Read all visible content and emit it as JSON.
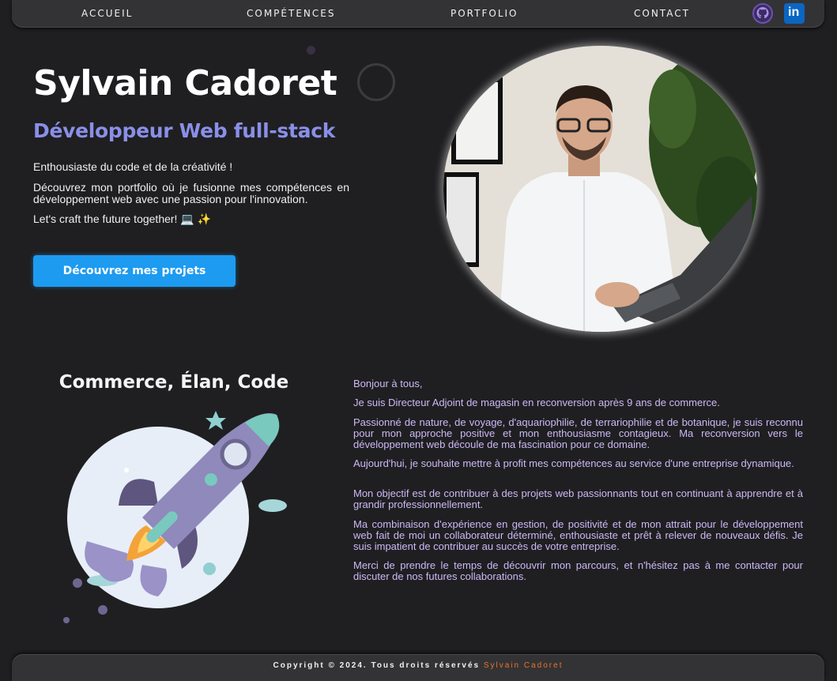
{
  "nav": {
    "items": [
      "ACCUEIL",
      "COMPÉTENCES",
      "PORTFOLIO",
      "CONTACT"
    ],
    "github_icon": "github-icon",
    "linkedin_icon": "linkedin-icon",
    "linkedin_text": "in"
  },
  "hero": {
    "name": "Sylvain Cadoret",
    "role": "Développeur Web full-stack",
    "p1": "Enthousiaste du code et de la créativité !",
    "p2": "Découvrez mon portfolio où je fusionne mes compétences en développement web avec une passion pour l'innovation.",
    "p3": "Let's craft the future together! 💻 ✨",
    "cta": "Découvrez mes projets"
  },
  "about": {
    "subtitle": "Commerce, Élan, Code",
    "paragraphs": [
      "Bonjour à tous,",
      "Je suis Directeur Adjoint de magasin en reconversion après 9 ans de commerce.",
      "Passionné de nature, de voyage, d'aquariophilie, de terrariophilie et de botanique, je suis reconnu pour mon approche positive et mon enthousiasme contagieux. Ma reconversion vers le développement web découle de ma fascination pour ce domaine.",
      "Aujourd'hui, je souhaite mettre à profit mes compétences au service d'une entreprise dynamique.",
      "Mon objectif est de contribuer à des projets web passionnants tout en continuant à apprendre et à grandir professionnellement.",
      "Ma combinaison d'expérience en gestion, de positivité et de mon attrait pour le développement web fait de moi un collaborateur déterminé, enthousiaste et prêt à relever de nouveaux défis. Je suis impatient de contribuer au succès de votre entreprise.",
      "Merci de prendre le temps de découvrir mon parcours, et n'hésitez pas à me contacter pour discuter de nos futures collaborations."
    ]
  },
  "footer": {
    "copyright": "Copyright © 2024. Tous droits réservés",
    "author": "Sylvain Cadoret"
  },
  "colors": {
    "background": "#1f1f21",
    "accent_blue": "#1d9bf0",
    "role_purple": "#8a8fe8",
    "about_text": "#cdb8f6",
    "footer_author": "#e8742a"
  }
}
